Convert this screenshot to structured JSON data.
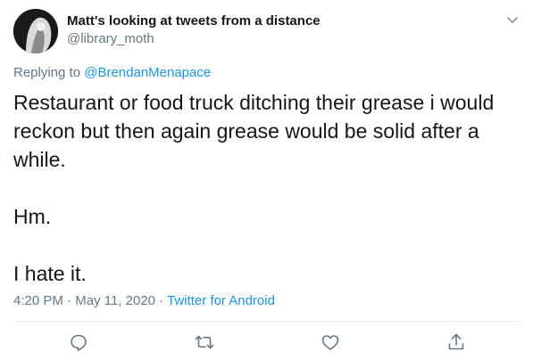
{
  "author": {
    "display_name": "Matt's looking at tweets from a distance",
    "handle": "@library_moth"
  },
  "reply": {
    "prefix": "Replying to ",
    "mention": "@BrendanMenapace"
  },
  "tweet": {
    "paragraphs": [
      "Restaurant or food truck ditching their grease i would reckon but then again grease would be solid after a while.",
      "Hm.",
      "I hate it."
    ]
  },
  "meta": {
    "time": "4:20 PM",
    "separator": " · ",
    "date": "May 11, 2020",
    "source": "Twitter for Android"
  },
  "icons": {
    "more": "chevron-down-icon",
    "reply": "reply-icon",
    "retweet": "retweet-icon",
    "like": "heart-icon",
    "share": "share-icon"
  },
  "colors": {
    "link": "#1b95e0",
    "secondary_text": "#657786",
    "primary_text": "#14171a"
  }
}
